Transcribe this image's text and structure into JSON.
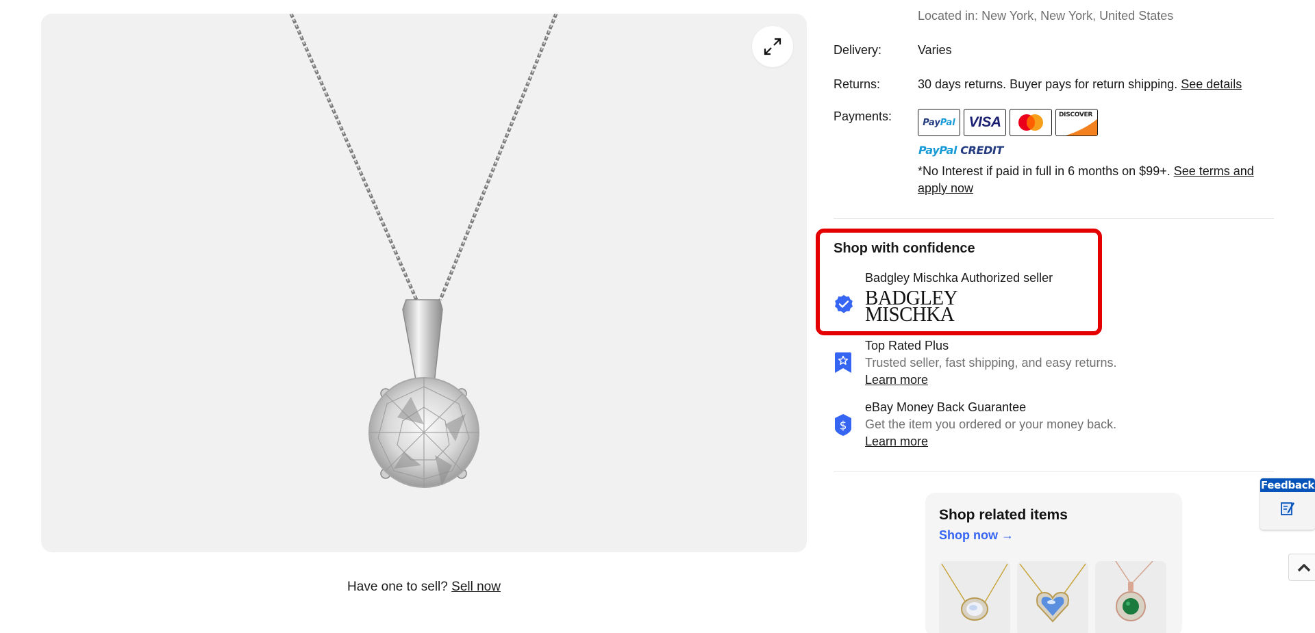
{
  "product_image": {
    "alt": "Round solitaire pendant necklace on box chain",
    "expand_icon": "expand-arrows-icon"
  },
  "sell_prompt": {
    "text": "Have one to sell?",
    "link": "Sell now"
  },
  "shipping": {
    "located_in": "Located in: New York, New York, United States"
  },
  "details": {
    "delivery": {
      "label": "Delivery:",
      "value": "Varies"
    },
    "returns": {
      "label": "Returns:",
      "value": "30 days returns. Buyer pays for return shipping.",
      "link": "See details"
    },
    "payments": {
      "label": "Payments:",
      "methods": [
        {
          "name": "PayPal",
          "icon": "paypal-icon"
        },
        {
          "name": "VISA",
          "icon": "visa-icon"
        },
        {
          "name": "Mastercard",
          "icon": "mastercard-icon"
        },
        {
          "name": "DISCOVER",
          "icon": "discover-icon"
        }
      ],
      "paypal_credit_a": "PayPal",
      "paypal_credit_b": "CREDIT",
      "financing_text": "*No Interest if paid in full in 6 months on $99+.",
      "financing_link": "See terms and apply now"
    }
  },
  "confidence": {
    "title": "Shop with confidence",
    "highlight_color": "#e50000",
    "authorized": {
      "title": "Badgley Mischka Authorized seller",
      "logo_line1": "BADGLEY",
      "logo_line2": "MISCHKA",
      "icon": "verified-check-icon"
    },
    "top_rated": {
      "title": "Top Rated Plus",
      "subtitle": "Trusted seller, fast shipping, and easy returns.",
      "link": "Learn more",
      "icon": "star-ribbon-icon"
    },
    "money_back": {
      "title": "eBay Money Back Guarantee",
      "subtitle": "Get the item you ordered or your money back.",
      "link": "Learn more",
      "icon": "dollar-shield-icon"
    },
    "accent_color": "#3665f3"
  },
  "related": {
    "title": "Shop related items",
    "link": "Shop now →",
    "items": [
      {
        "name": "Oval opal halo necklace"
      },
      {
        "name": "Heart moonstone halo necklace"
      },
      {
        "name": "Round emerald halo pendant"
      }
    ]
  },
  "feedback": {
    "label": "Feedback"
  }
}
